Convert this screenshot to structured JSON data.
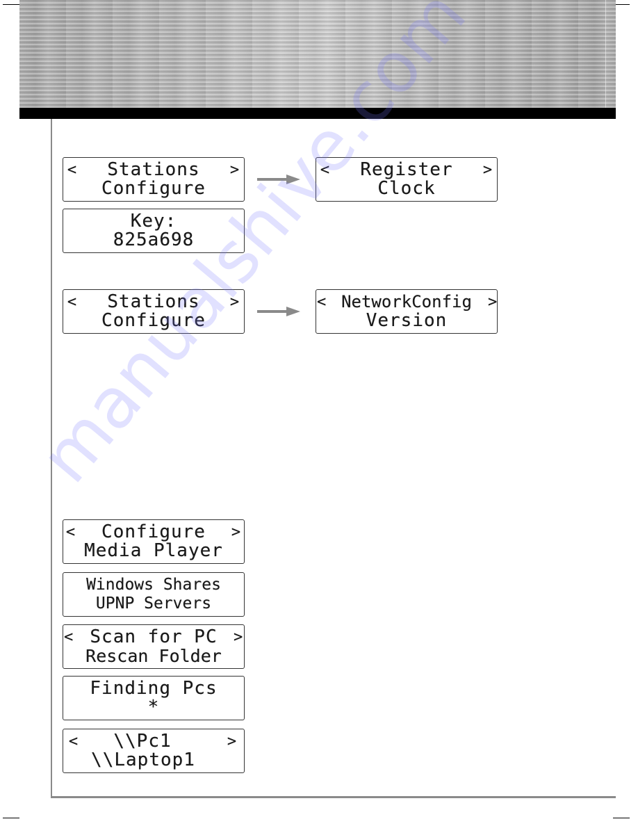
{
  "watermark": "manualshive.com",
  "colors": {
    "banner_base": "#b4b4b4",
    "black_bar": "#000000",
    "frame": "#8a8a8a",
    "arrow": "#8a8a8a",
    "lcd_text": "#1a1a1a",
    "watermark": "#9c9cff"
  },
  "screens": {
    "stations_configure_1": {
      "left_nav": "<",
      "line1": "Stations",
      "right_nav": ">",
      "line2": "Configure"
    },
    "key": {
      "line1": "Key:",
      "line2": "825a698"
    },
    "register_clock": {
      "left_nav": "<",
      "line1": "Register",
      "right_nav": ">",
      "line2": "Clock"
    },
    "stations_configure_2": {
      "left_nav": "<",
      "line1": "Stations",
      "right_nav": ">",
      "line2": "Configure"
    },
    "network_version": {
      "left_nav": "<",
      "line1": "NetworkConfig",
      "right_nav": ">",
      "line2": "Version"
    },
    "configure_media": {
      "left_nav": "<",
      "line1": "Configure",
      "right_nav": ">",
      "line2": "Media Player"
    },
    "shares_upnp": {
      "line1": "Windows Shares",
      "line2": "UPNP Servers"
    },
    "scan_rescan": {
      "left_nav": "<",
      "line1": "Scan for PC",
      "right_nav": ">",
      "line2": "Rescan Folder"
    },
    "finding": {
      "line1": "Finding Pcs",
      "line2": "*"
    },
    "pc_laptop": {
      "left_nav": "<",
      "line1": "\\\\Pc1",
      "right_nav": ">",
      "line2": "\\\\Laptop1"
    }
  },
  "icons": {
    "arrow": "right-arrow-icon"
  }
}
